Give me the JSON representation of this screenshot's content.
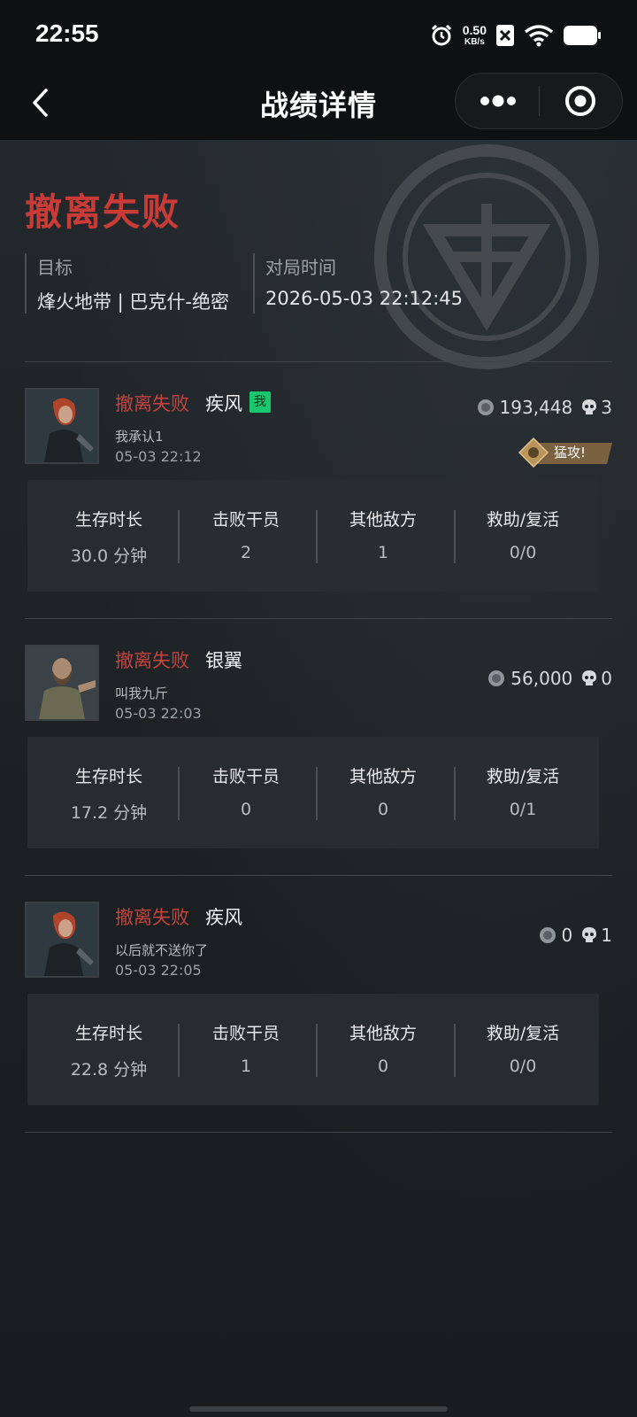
{
  "status_bar": {
    "time": "22:55",
    "net_speed_value": "0.50",
    "net_speed_unit": "KB/s"
  },
  "nav": {
    "title": "战绩详情"
  },
  "summary": {
    "result": "撤离失败",
    "target_label": "目标",
    "target_value": "烽火地带 | 巴克什-绝密",
    "time_label": "对局时间",
    "time_value": "2026-05-03 22:12:45"
  },
  "stat_labels": {
    "survival": "生存时长",
    "defeated": "击败干员",
    "other_enemies": "其他敌方",
    "assist_revive": "救助/复活"
  },
  "players": [
    {
      "result": "撤离失败",
      "name": "疾风",
      "me_badge": "我",
      "subtitle": "我承认1",
      "date": "05-03 22:12",
      "coins": "193,448",
      "kills": "3",
      "tag": "猛攻!",
      "stats": {
        "survival": "30.0 分钟",
        "defeated": "2",
        "other_enemies": "1",
        "assist_revive": "0/0"
      }
    },
    {
      "result": "撤离失败",
      "name": "银翼",
      "subtitle": "叫我九斤",
      "date": "05-03 22:03",
      "coins": "56,000",
      "kills": "0",
      "stats": {
        "survival": "17.2 分钟",
        "defeated": "0",
        "other_enemies": "0",
        "assist_revive": "0/1"
      }
    },
    {
      "result": "撤离失败",
      "name": "疾风",
      "subtitle": "以后就不送你了",
      "date": "05-03 22:05",
      "coins": "0",
      "kills": "1",
      "stats": {
        "survival": "22.8 分钟",
        "defeated": "1",
        "other_enemies": "0",
        "assist_revive": "0/0"
      }
    }
  ],
  "colors": {
    "fail_red": "#c93b36",
    "me_badge_green": "#19c86e",
    "tag_gold": "#b8955a"
  }
}
